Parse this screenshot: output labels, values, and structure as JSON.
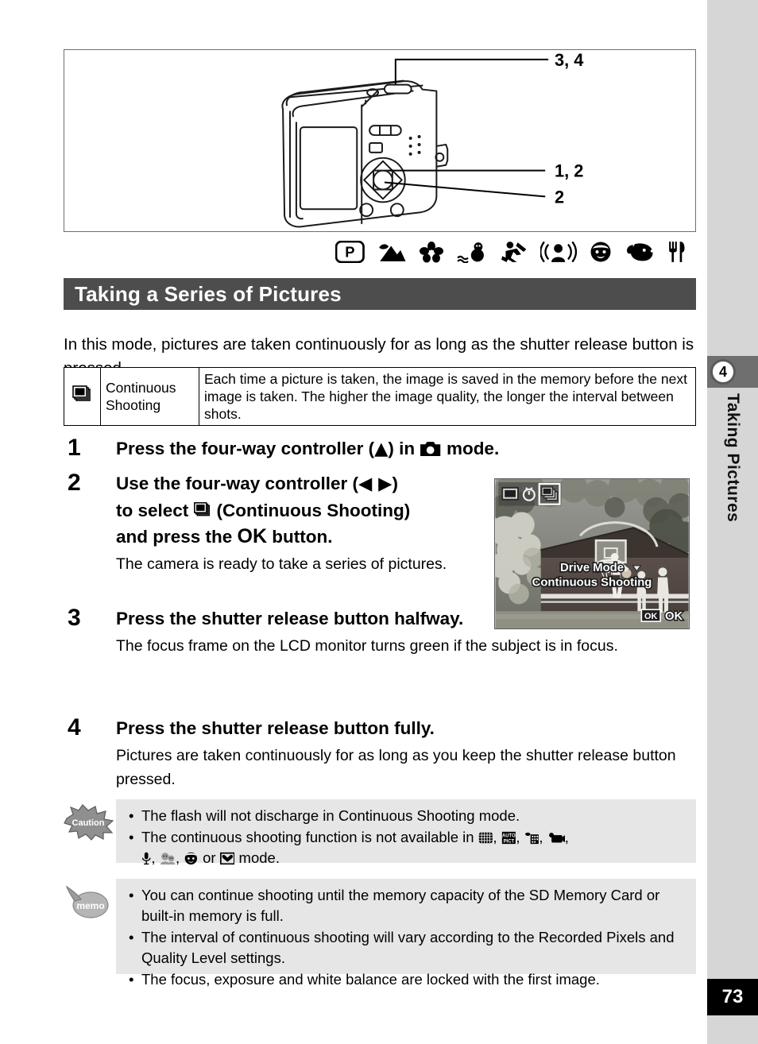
{
  "page": {
    "number": "73",
    "chapter_number": "4",
    "chapter_title": "Taking Pictures"
  },
  "diagram": {
    "callout_top": "3, 4",
    "callout_middle": "1, 2",
    "callout_bottom": "2",
    "subject": "camera-rear-view"
  },
  "mode_strip": {
    "icons": [
      "program-mode-icon",
      "landscape-mode-icon",
      "flower-mode-icon",
      "surf-and-snow-mode-icon",
      "sport-mode-icon",
      "digital-sr-mode-icon",
      "kids-mode-icon",
      "pet-mode-icon",
      "food-mode-icon"
    ]
  },
  "section": {
    "title": "Taking a Series of Pictures",
    "intro": "In this mode, pictures are taken continuously for as long as the shutter release button is pressed."
  },
  "definition_table": {
    "icon": "continuous-shooting-icon",
    "name": "Continuous Shooting",
    "description": "Each time a picture is taken, the image is saved in the memory before the next image is taken. The higher the image quality, the longer the interval between shots."
  },
  "steps": [
    {
      "num": "1",
      "head_pre": "Press the four-way controller (",
      "head_arrow": "▲",
      "head_mid": ") in ",
      "head_icon": "still-picture-mode-icon",
      "head_post": " mode.",
      "text": ""
    },
    {
      "num": "2",
      "head_line1_pre": "Use the four-way controller (",
      "head_line1_arrows": "◀ ▶",
      "head_line1_post": ")",
      "head_line2_pre": "to select ",
      "head_line2_icon": "continuous-shooting-icon",
      "head_line2_post": " (Continuous Shooting)",
      "head_line3_pre": "and press the ",
      "head_line3_ok": "OK",
      "head_line3_post": " button.",
      "text": "The camera is ready to take a series of pictures."
    },
    {
      "num": "3",
      "head": "Press the shutter release button halfway.",
      "text": "The focus frame on the LCD monitor turns green if the subject is in focus."
    },
    {
      "num": "4",
      "head": "Press the shutter release button fully.",
      "text": "Pictures are taken continuously for as long as you keep the shutter release button pressed."
    }
  ],
  "lcd": {
    "drive_mode_label": "Drive Mode",
    "selected_mode_label": "Continuous Shooting",
    "ok_button_label": "OK",
    "ok_icon_label": "OK",
    "top_icons": [
      "standard-drive-icon",
      "self-timer-icon",
      "continuous-shooting-icon"
    ],
    "scene": "basketball-court-photo"
  },
  "caution": {
    "badge_label": "Caution",
    "bullets": [
      {
        "text": "The flash will not discharge in Continuous Shooting mode."
      },
      {
        "pre": "The continuous shooting function is not available in ",
        "icons": [
          "panorama-assist-icon",
          "auto-picture-icon",
          "night-scene-icon",
          "movie-icon",
          "voice-recording-icon",
          "kids-mode-icon",
          "natural-skin-tone-icon",
          "frame-composite-icon"
        ],
        "post": " mode.",
        "separator": ", ",
        "or_word": " or "
      }
    ]
  },
  "memo": {
    "badge_label": "memo",
    "bullets": [
      "You can continue shooting until the memory capacity of the SD Memory Card or built-in memory is full.",
      "The interval of continuous shooting will vary according to the Recorded Pixels and Quality Level settings.",
      "The focus, exposure and white balance are locked with the first image."
    ]
  },
  "colors": {
    "section_bar": "#4d4d4d",
    "sidebar": "#d6d6d6",
    "chapter_tab": "#6f6f6f",
    "note_box": "#e6e6e6",
    "page_number_box": "#000000"
  }
}
